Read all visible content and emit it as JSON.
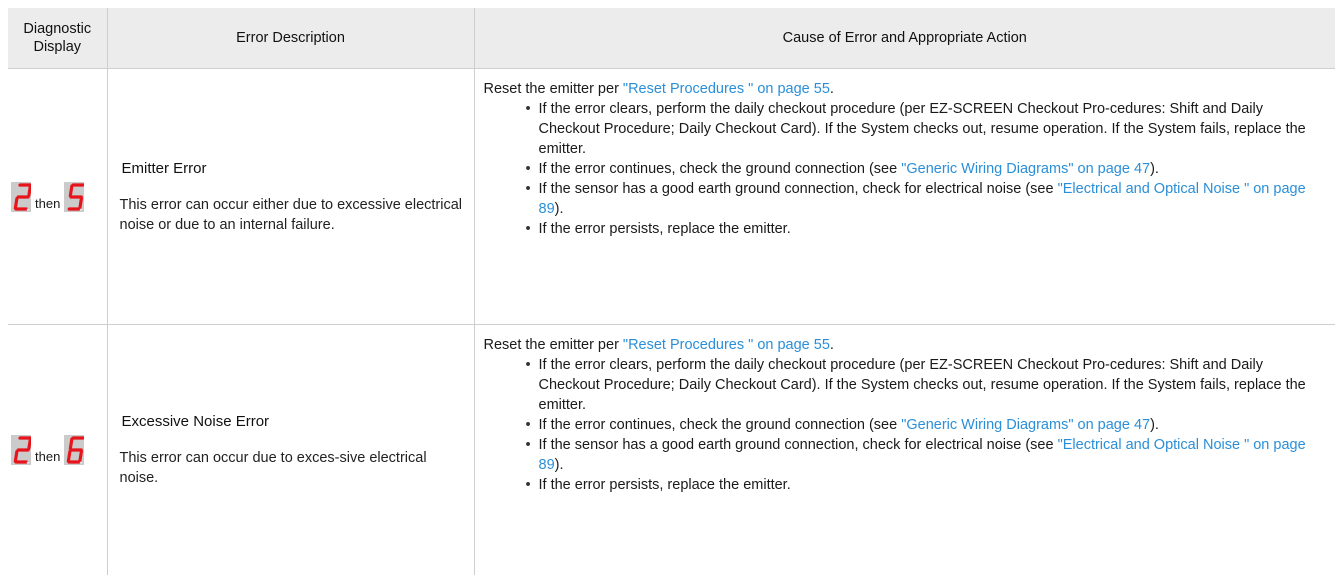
{
  "table": {
    "headers": [
      "Diagnostic Display",
      "Error Description",
      "Cause of Error and Appropriate Action"
    ],
    "rows": [
      {
        "digit_a": "2",
        "digit_b": "5",
        "then_label": "then",
        "error_title": "Emitter Error",
        "error_text": "This error can occur either due to excessive electrical noise or due to an internal failure.",
        "reset_prefix": "Reset the emitter per ",
        "reset_link": "\"Reset Procedures \" on page 55",
        "reset_suffix": ".",
        "bullets": [
          {
            "text": "If the error clears, perform the daily checkout procedure (per EZ-SCREEN Checkout Pro-cedures: Shift and Daily Checkout Procedure; Daily Checkout Card). If the System checks out, resume operation. If the System fails, replace the emitter."
          },
          {
            "pre": "If the error continues, check the ground connection (see ",
            "link": "\"Generic Wiring Diagrams\" on page 47",
            "post": ")."
          },
          {
            "pre": "If the sensor has a good earth ground connection, check for electrical noise (see ",
            "link": "\"Electrical and Optical Noise \" on page 89",
            "post": ")."
          },
          {
            "text": "If the error persists, replace the emitter."
          }
        ]
      },
      {
        "digit_a": "2",
        "digit_b": "6",
        "then_label": "then",
        "error_title": "Excessive Noise Error",
        "error_text": "This error can occur due to exces-sive electrical noise.",
        "reset_prefix": "Reset the emitter per ",
        "reset_link": "\"Reset Procedures \" on page 55",
        "reset_suffix": ".",
        "bullets": [
          {
            "text": "If the error clears, perform the daily checkout procedure (per EZ-SCREEN Checkout Pro-cedures: Shift and Daily Checkout Procedure; Daily Checkout Card). If the System checks out, resume operation. If the System fails, replace the emitter."
          },
          {
            "pre": "If the error continues, check the ground connection (see ",
            "link": "\"Generic Wiring Diagrams\" on page 47",
            "post": ")."
          },
          {
            "pre": "If the sensor has a good earth ground connection, check for electrical noise (see ",
            "link": "\"Electrical and Optical Noise \" on page 89",
            "post": ")."
          },
          {
            "text": "If the error persists, replace the emitter."
          }
        ]
      }
    ]
  },
  "colors": {
    "segment": "#e8141b",
    "digit_bg": "#cbcbcb",
    "header_bg": "#ececec",
    "link": "#2a8fd8"
  }
}
